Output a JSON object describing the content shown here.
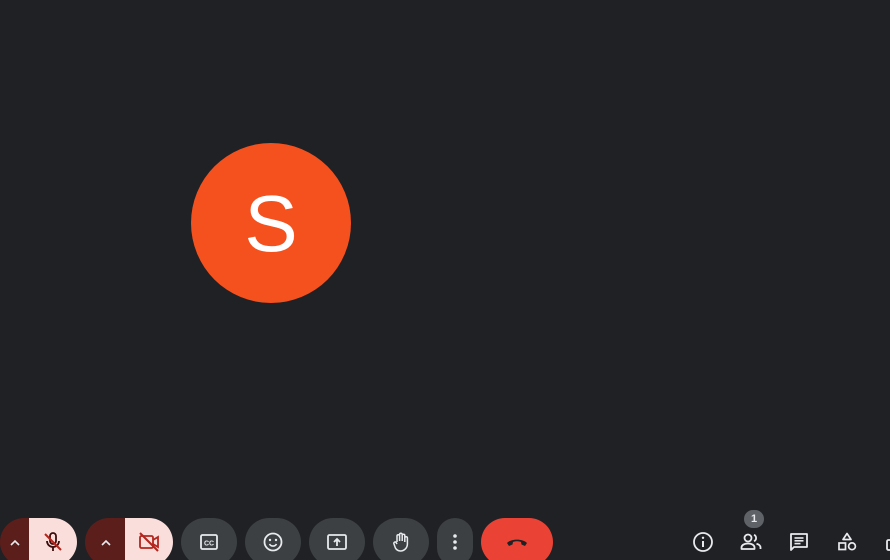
{
  "participant": {
    "initial": "S",
    "avatar_color": "#f4511e"
  },
  "toolbar": {
    "mic_options_icon": "chevron-up-icon",
    "mic_icon": "mic-off-icon",
    "camera_options_icon": "chevron-up-icon",
    "camera_icon": "videocam-off-icon",
    "captions_icon": "closed-captions-icon",
    "reactions_icon": "emoji-icon",
    "present_icon": "present-screen-icon",
    "raise_hand_icon": "hand-icon",
    "more_icon": "more-vert-icon",
    "leave_icon": "call-end-icon",
    "leave_color": "#ea4335"
  },
  "side_panel": {
    "info_icon": "info-icon",
    "people_icon": "people-icon",
    "people_count": "1",
    "chat_icon": "chat-icon",
    "activities_icon": "activities-icon",
    "lock_icon": "host-controls-icon"
  },
  "colors": {
    "background": "#202124",
    "button": "#3c4043",
    "muted_button": "#f9dedc",
    "muted_icon": "#b3261e",
    "icon": "#e8eaed"
  }
}
